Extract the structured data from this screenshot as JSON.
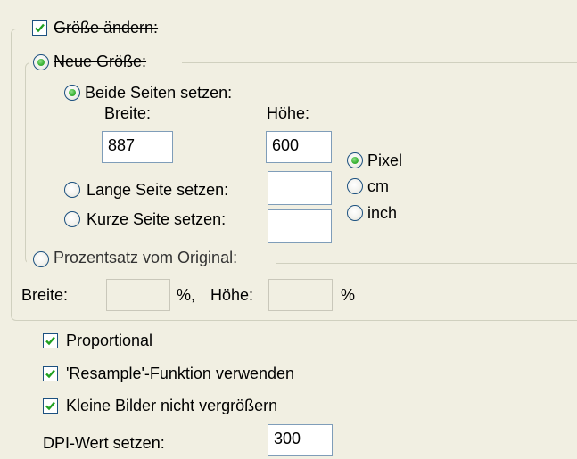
{
  "resize": {
    "label": "Größe ändern:",
    "checked": true
  },
  "new_size": {
    "label": "Neue Größe:",
    "selected": true,
    "both_sides": {
      "label": "Beide Seiten setzen:",
      "selected": true,
      "width_label": "Breite:",
      "height_label": "Höhe:",
      "width_value": "887",
      "height_value": "600"
    },
    "long_side": {
      "label": "Lange Seite setzen:",
      "selected": false,
      "value": ""
    },
    "short_side": {
      "label": "Kurze Seite setzen:",
      "selected": false,
      "value": ""
    },
    "units": [
      {
        "label": "Pixel",
        "selected": true
      },
      {
        "label": "cm",
        "selected": false
      },
      {
        "label": "inch",
        "selected": false
      }
    ]
  },
  "percentage": {
    "label": "Prozentsatz vom Original:",
    "selected": false,
    "width_label": "Breite:",
    "width_value": "",
    "width_unit": "%,",
    "height_label": "Höhe:",
    "height_value": "",
    "height_unit": "%"
  },
  "options": [
    {
      "label": "Proportional",
      "checked": true
    },
    {
      "label": "'Resample'-Funktion verwenden",
      "checked": true
    },
    {
      "label": "Kleine Bilder nicht vergrößern",
      "checked": true
    }
  ],
  "dpi": {
    "label": "DPI-Wert setzen:",
    "value": "300"
  },
  "colors": {
    "background": "#f1efe2",
    "check_green": "#21a121",
    "border_blue": "#1c5180"
  }
}
